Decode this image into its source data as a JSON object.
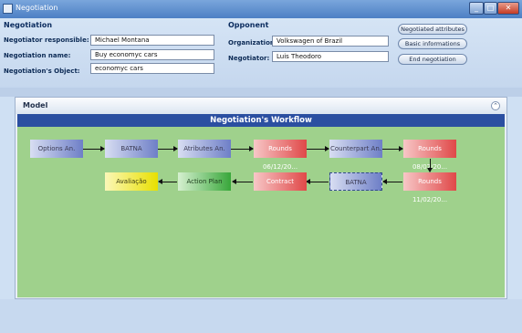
{
  "window": {
    "title": "Negotiation"
  },
  "negotiation": {
    "section_title": "Negotiation",
    "responsible_label": "Negotiator responsible:",
    "responsible_value": "Michael Montana",
    "name_label": "Negotiation name:",
    "name_value": "Buy economyc cars",
    "object_label": "Negotiation's Object:",
    "object_value": "economyc cars"
  },
  "opponent": {
    "section_title": "Opponent",
    "organization_label": "Organization:",
    "organization_value": "Volkswagen of Brazil",
    "negotiator_label": "Negotiator:",
    "negotiator_value": "Luis Theodoro"
  },
  "actions": {
    "negotiated_attributes": "Negotiated attributes",
    "basic_informations": "Basic informations",
    "end_negotiation": "End negotiation"
  },
  "model": {
    "panel_title": "Model",
    "workflow_title": "Negotiation's Workflow",
    "nodes": {
      "options": "Options An.",
      "batna1": "BATNA",
      "attributes": "Atributes An.",
      "rounds1": "Rounds 06/12/20...",
      "counterpart": "Counterpart An.",
      "rounds2": "Rounds 08/02/20...",
      "rounds3": "Rounds 11/02/20...",
      "batna2": "BATNA",
      "contract": "Contract",
      "action_plan": "Action Plan",
      "avaliacao": "Avaliação"
    },
    "colors": {
      "blue": "#6e7fc7",
      "red": "#e04848",
      "green": "#38a73a",
      "yellow": "#e8e000",
      "workflow_bg": "#9fd18c",
      "header_bar": "#2b4fa1"
    }
  },
  "icons": {
    "window_icon": "app-window-icon",
    "collapse": "chevron-up-circle-icon"
  }
}
